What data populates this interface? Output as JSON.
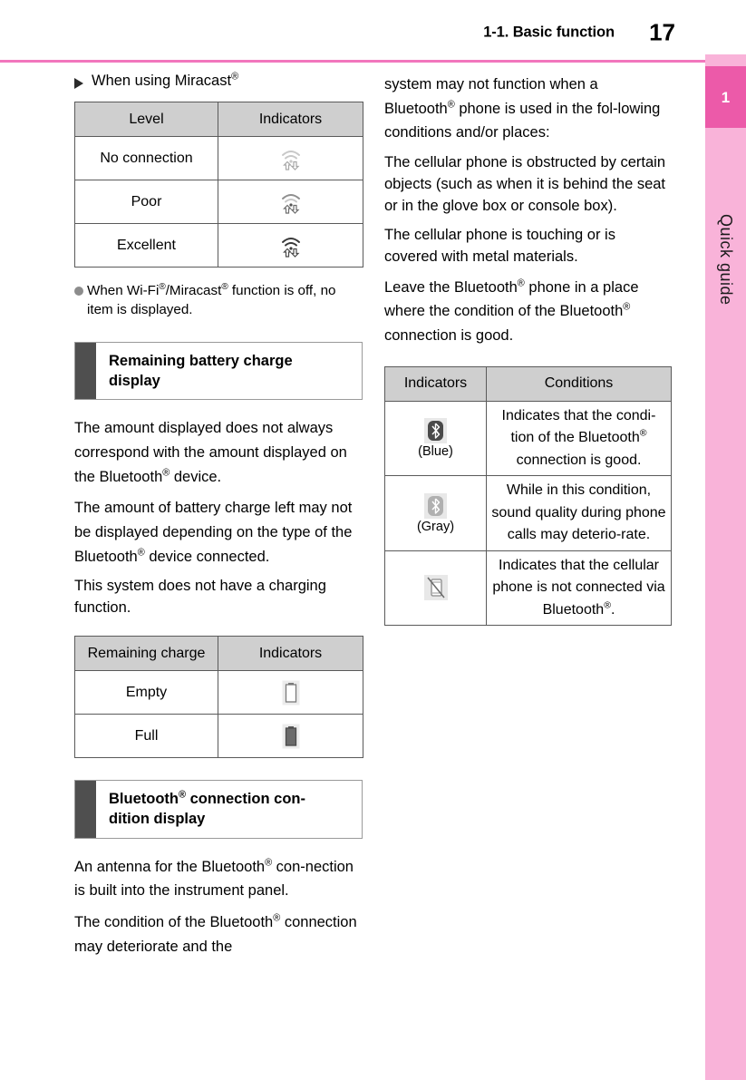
{
  "header": {
    "title": "1-1. Basic function",
    "page_number": "17"
  },
  "sidebar": {
    "chapter_number": "1",
    "chapter_label": "Quick guide",
    "tab_color": "#ec5aa9",
    "strip_color": "#f9b3d9",
    "rule_color": "#f276bd"
  },
  "left_column": {
    "subhead": {
      "text": "When using Miracast",
      "reg": "®"
    },
    "miracast_table": {
      "headers": [
        "Level",
        "Indicators"
      ],
      "rows": [
        {
          "level": "No connection",
          "indicator": "wifi-none-icon",
          "bars": 0
        },
        {
          "level": "Poor",
          "indicator": "wifi-poor-icon",
          "bars": 1
        },
        {
          "level": "Excellent",
          "indicator": "wifi-excellent-icon",
          "bars": 3
        }
      ]
    },
    "note": {
      "part1": "When Wi-Fi",
      "reg1": "®",
      "part2": "/Miracast",
      "reg2": "®",
      "part3": " function is off, no item is displayed."
    },
    "section_battery": {
      "title_line1": "Remaining battery charge",
      "title_line2": "display",
      "bar_color": "#4f4f4f"
    },
    "paragraphs_battery": [
      {
        "p1": "The amount displayed does not always correspond with the amount displayed on the Bluetooth",
        "reg": "®",
        "p2": " device."
      },
      {
        "p1": "The amount of battery charge left may not be displayed depending on the type of the Bluetooth",
        "reg": "®",
        "p2": " device connected."
      },
      {
        "p1": "This system does not have a charging function.",
        "reg": "",
        "p2": ""
      }
    ],
    "charge_table": {
      "headers": [
        "Remaining charge",
        "Indicators"
      ],
      "rows": [
        {
          "label": "Empty",
          "indicator": "battery-empty-icon",
          "level": 0
        },
        {
          "label": "Full",
          "indicator": "battery-full-icon",
          "level": 100
        }
      ]
    },
    "section_bluetooth": {
      "title_part1": "Bluetooth",
      "reg": "®",
      "title_part2": " connection con-",
      "title_line2": "dition display",
      "bar_color": "#4f4f4f"
    },
    "paragraphs_bluetooth": [
      {
        "p1": "An antenna for the Bluetooth",
        "reg": "®",
        "p2": " con-nection is built into the instrument panel."
      },
      {
        "p1": "The condition of the Bluetooth",
        "reg": "®",
        "p2": " connection may deteriorate and the"
      }
    ]
  },
  "right_column": {
    "paragraphs": [
      {
        "p1": "system may not function when a Bluetooth",
        "reg": "®",
        "p2": " phone is used in the fol-lowing conditions and/or places:"
      },
      {
        "p1": "The cellular phone is obstructed by certain objects (such as when it is behind the seat or in the glove box or console box).",
        "reg": "",
        "p2": ""
      },
      {
        "p1": "The cellular phone is touching or is covered with metal materials.",
        "reg": "",
        "p2": ""
      },
      {
        "p1": "Leave the Bluetooth",
        "reg": "®",
        "p2": " phone in a place where the condition of the Bluetooth"
      }
    ],
    "paragraph_tail": {
      "reg": "®",
      "text": " connection is good."
    },
    "conditions_table": {
      "headers": [
        "Indicators",
        "Conditions"
      ],
      "rows": [
        {
          "indicator": "bluetooth-blue-icon",
          "caption": "(Blue)",
          "icon_color": "#4a4a4a",
          "condition_p1": "Indicates that the condi-tion of the Bluetooth",
          "condition_reg": "®",
          "condition_p2": " connection is good."
        },
        {
          "indicator": "bluetooth-gray-icon",
          "caption": "(Gray)",
          "icon_color": "#a8a8a8",
          "condition_p1": "While in this condition, sound quality during phone calls may deterio-rate.",
          "condition_reg": "",
          "condition_p2": ""
        },
        {
          "indicator": "phone-disconnected-icon",
          "caption": "",
          "icon_color": "#8a8a8a",
          "condition_p1": "Indicates that the cellular phone is not connected via Bluetooth",
          "condition_reg": "®",
          "condition_p2": "."
        }
      ]
    }
  }
}
